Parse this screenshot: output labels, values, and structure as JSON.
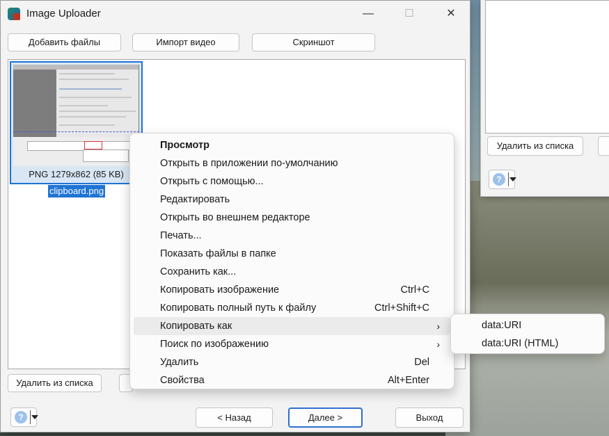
{
  "window": {
    "title": "Image Uploader",
    "controls": [
      "—",
      "☐",
      "✕"
    ]
  },
  "toolbar": {
    "add_files": "Добавить файлы",
    "import_video": "Импорт видео",
    "screenshot": "Скриншот"
  },
  "file_list": {
    "item": {
      "caption": "PNG 1279x862 (85 KB)",
      "filename": "clipboard.png"
    }
  },
  "bottom": {
    "remove_from_list": "Удалить из списка",
    "help": "?",
    "back": "< Назад",
    "next": "Далее >",
    "exit": "Выход"
  },
  "background_window": {
    "remove_from_list": "Удалить из списка",
    "help": "?"
  },
  "context_menu": {
    "items": [
      {
        "label": "Просмотр",
        "shortcut": "",
        "bold": true
      },
      {
        "label": "Открыть в приложении по-умолчанию",
        "shortcut": ""
      },
      {
        "label": "Открыть с помощью...",
        "shortcut": ""
      },
      {
        "label": "Редактировать",
        "shortcut": ""
      },
      {
        "label": "Открыть во внешнем редакторе",
        "shortcut": ""
      },
      {
        "label": "Печать...",
        "shortcut": ""
      },
      {
        "label": "Показать файлы в папке",
        "shortcut": ""
      },
      {
        "label": "Сохранить как...",
        "shortcut": ""
      },
      {
        "label": "Копировать изображение",
        "shortcut": "Ctrl+C"
      },
      {
        "label": "Копировать полный путь к файлу",
        "shortcut": "Ctrl+Shift+C"
      },
      {
        "label": "Копировать как",
        "shortcut": "",
        "submenu": true
      },
      {
        "label": "Поиск по изображению",
        "shortcut": "",
        "submenu": true
      },
      {
        "label": "Удалить",
        "shortcut": "Del"
      },
      {
        "label": "Свойства",
        "shortcut": "Alt+Enter"
      }
    ],
    "submenu_arrow": "›"
  },
  "submenu": {
    "items": [
      "data:URI",
      "data:URI (HTML)"
    ]
  }
}
